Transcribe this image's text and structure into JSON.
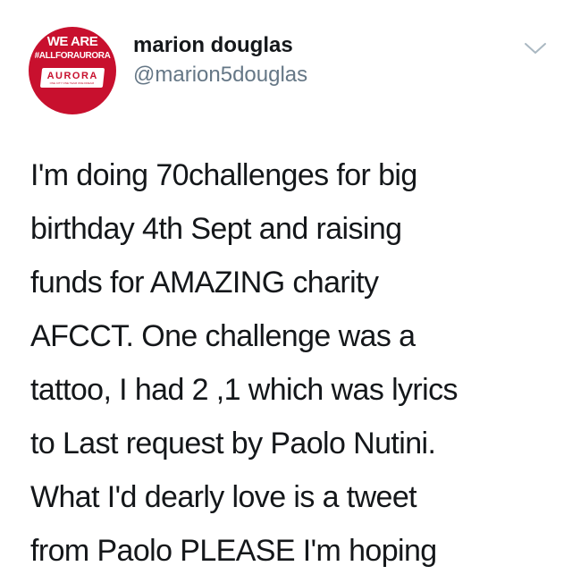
{
  "user": {
    "display_name": "marion douglas",
    "handle": "@marion5douglas",
    "avatar": {
      "line1": "WE ARE",
      "line2": "#ALLFORAURORA",
      "brand": "AURORA",
      "tagline": "ONE CITY ONE TEAM ONE DREAM"
    }
  },
  "menu": {
    "icon": "chevron-down-icon"
  },
  "tweet": {
    "lines": [
      "I'm doing 70challenges for big",
      "birthday 4th Sept and raising",
      "funds for AMAZING charity",
      "AFCCT. One challenge was a",
      "tattoo, I had 2 ,1  which was lyrics",
      "to Last request by Paolo Nutini.",
      "What I'd dearly love is a tweet",
      "from Paolo PLEASE I'm hoping"
    ]
  },
  "colors": {
    "avatar_bg": "#c8102e",
    "text_primary": "#14171a",
    "text_secondary": "#657786",
    "caret": "#aab8c2"
  }
}
